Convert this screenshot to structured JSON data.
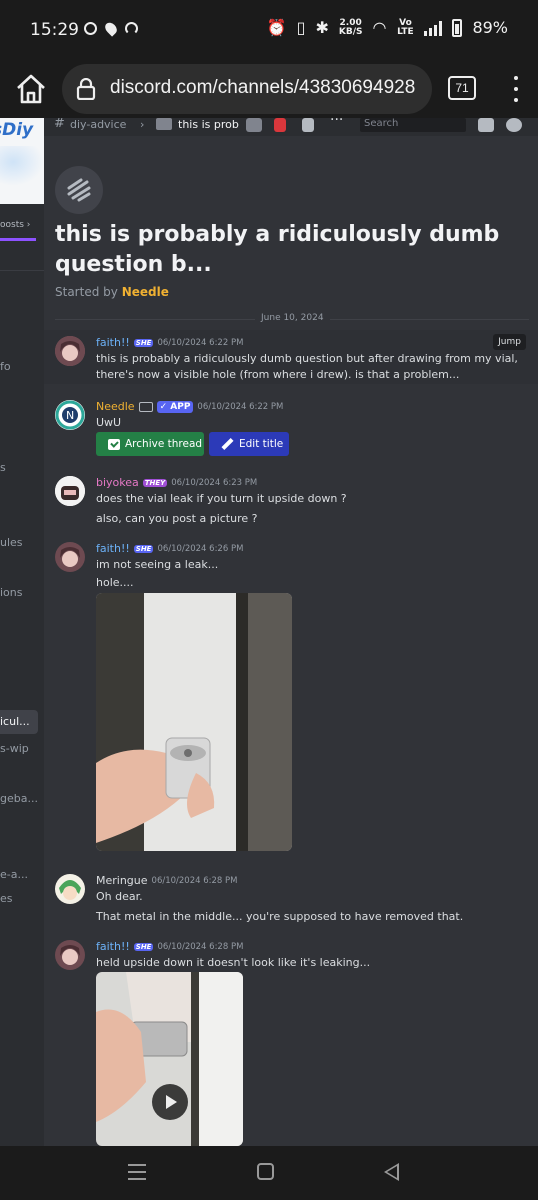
{
  "status_bar": {
    "time": "15:29",
    "net_speed_value": "2.00",
    "net_speed_unit": "KB/S",
    "volte_label": "Vo LTE",
    "battery": "89%"
  },
  "browser": {
    "url": "discord.com/channels/43830694928",
    "tab_count": "71"
  },
  "sidebar": {
    "banner_text": "sDiy",
    "boosts_label": "oosts",
    "items": [
      {
        "label": "fo"
      },
      {
        "label": "s"
      },
      {
        "label": "ules"
      },
      {
        "label": "ions"
      },
      {
        "label": "icul..."
      },
      {
        "label": "s-wip"
      },
      {
        "label": "geba..."
      },
      {
        "label": "e-a..."
      },
      {
        "label": "es"
      }
    ]
  },
  "topbar": {
    "channel": "diy-advice",
    "thread": "this is prob",
    "search_placeholder": "Search"
  },
  "thread": {
    "title": "this is probably a ridiculously dumb question b...",
    "started_by_prefix": "Started by",
    "started_by_name": "Needle",
    "date_divider": "June 10, 2024"
  },
  "messages": [
    {
      "author": "faith!!",
      "tag": "SHE",
      "time": "06/10/2024 6:22 PM",
      "lines": [
        "this is probably a ridiculously dumb question but after drawing from my vial,",
        "there's now a visible hole (from where i drew). is that a problem..."
      ],
      "jump_label": "Jump",
      "name_color": "#6cb1f7"
    },
    {
      "author": "Needle",
      "app_tag": "✓ APP",
      "time": "06/10/2024 6:22 PM",
      "lines": [
        "UwU"
      ],
      "archive_label": "Archive thread",
      "edit_label": "Edit title",
      "name_color": "#f0b132"
    },
    {
      "author": "biyokea",
      "tag": "THEY",
      "time": "06/10/2024 6:23 PM",
      "lines": [
        "does the vial leak if you turn it upside down ?",
        "also, can you post a picture ?"
      ],
      "name_color": "#e579c6"
    },
    {
      "author": "faith!!",
      "tag": "SHE",
      "time": "06/10/2024 6:26 PM",
      "lines": [
        "im not seeing a leak...",
        "hole...."
      ],
      "name_color": "#6cb1f7"
    },
    {
      "author": "Meringue",
      "time": "06/10/2024 6:28 PM",
      "lines": [
        "Oh dear.",
        "That metal in the middle... you're supposed to have removed that."
      ],
      "name_color": "#dbdee1"
    },
    {
      "author": "faith!!",
      "tag": "SHE",
      "time": "06/10/2024 6:28 PM",
      "lines": [
        "held upside down it doesn't look like it's leaking..."
      ],
      "name_color": "#6cb1f7"
    }
  ],
  "icons": [
    "home-icon",
    "lock-icon",
    "tabs-icon",
    "more-icon",
    "threads-icon",
    "play-icon",
    "check-icon",
    "pencil-icon"
  ]
}
